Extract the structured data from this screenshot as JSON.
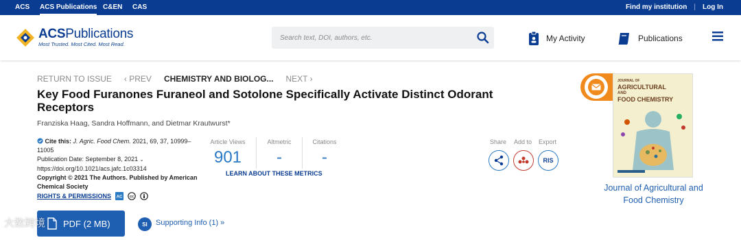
{
  "topbar": {
    "links": [
      "ACS",
      "ACS Publications",
      "C&EN",
      "CAS"
    ],
    "active": "ACS Publications",
    "find_institution": "Find my institution",
    "login": "Log In"
  },
  "header": {
    "logo_prefix": "ACS",
    "logo_suffix": "Publications",
    "tagline": "Most Trusted. Most Cited. Most Read.",
    "search_placeholder": "Search text, DOI, authors, etc.",
    "my_activity": "My Activity",
    "publications": "Publications"
  },
  "issue_nav": {
    "return": "RETURN TO ISSUE",
    "prev": "‹ PREV",
    "current": "CHEMISTRY AND BIOLOG...",
    "next": "NEXT ›"
  },
  "article": {
    "title": "Key Food Furanones Furaneol and Sotolone Specifically Activate Distinct Odorant Receptors",
    "authors": "Franziska Haag, Sandra Hoffmann, and Dietmar Krautwurst*",
    "cite_label": "Cite this:",
    "cite_journal": "J. Agric. Food Chem.",
    "cite_ref": "2021, 69, 37, 10999–11005",
    "pub_date": "Publication Date: September 8, 2021",
    "doi": "https://doi.org/10.1021/acs.jafc.1c03314",
    "copyright": "Copyright © 2021 The Authors. Published by American Chemical Society",
    "rights": "RIGHTS & PERMISSIONS"
  },
  "metrics": {
    "views_label": "Article Views",
    "views_value": "901",
    "altmetric_label": "Altmetric",
    "altmetric_value": "-",
    "citations_label": "Citations",
    "citations_value": "-",
    "learn_more": "LEARN ABOUT THESE METRICS"
  },
  "share": {
    "share_label": "Share",
    "add_label": "Add to",
    "export_label": "Export",
    "ris": "RIS"
  },
  "actions": {
    "pdf": "PDF (2 MB)",
    "si_badge": "SI",
    "supporting_info": "Supporting Info (1) »"
  },
  "journal": {
    "name": "Journal of Agricultural and Food Chemistry",
    "cover_line1": "JOURNAL OF",
    "cover_line2": "AGRICULTURAL",
    "cover_line3": "AND",
    "cover_line4": "FOOD CHEMISTRY"
  },
  "watermark": "大数跨境",
  "colors": {
    "brand_blue": "#0a3d91",
    "link_blue": "#1f5fb1",
    "metric_blue": "#2a79c4",
    "accent_orange": "#f08a1c"
  }
}
